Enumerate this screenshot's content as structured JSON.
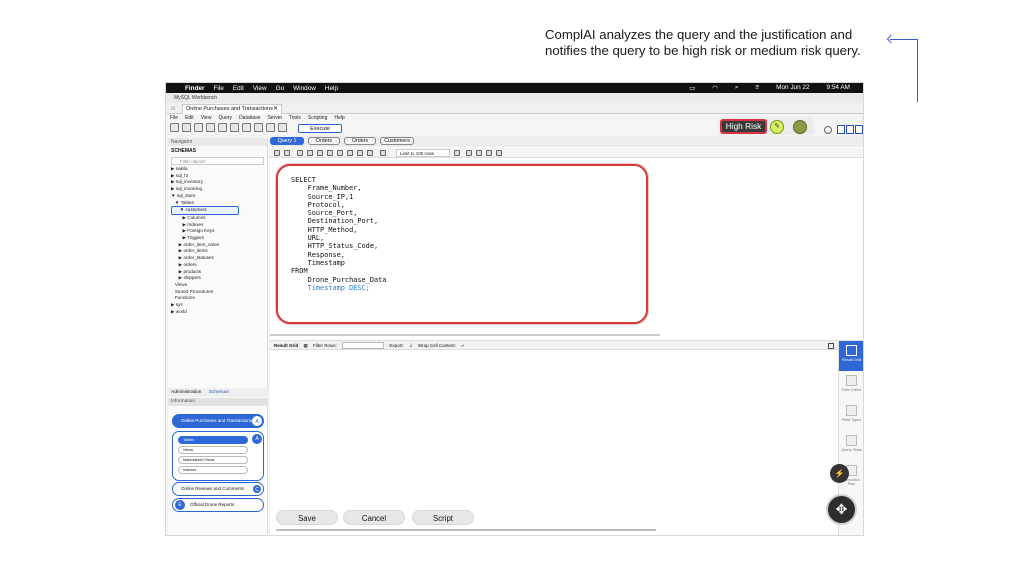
{
  "annotation": {
    "line1": "ComplAI analyzes the query and the justification and",
    "line2": "notifies the query to be high risk or medium risk query."
  },
  "mac_menubar": {
    "apple": "",
    "app": "Finder",
    "items": [
      "File",
      "Edit",
      "View",
      "Go",
      "Window",
      "Help"
    ],
    "date": "Mon Jun 22",
    "time": "9:54 AM"
  },
  "window": {
    "title": "MySQL Workbench",
    "connection_tab": "Online Purchases and Transactions",
    "close_glyph": "✕"
  },
  "app_menu": [
    "File",
    "Edit",
    "View",
    "Query",
    "Database",
    "Server",
    "Tools",
    "Scripting",
    "Help"
  ],
  "toolbar": {
    "execute_label": "Execute"
  },
  "risk": {
    "label": "High Risk",
    "color": "#d63444",
    "pencil_glyph": "✎"
  },
  "sidebar": {
    "navigator": "Navigator",
    "schemas": "SCHEMAS",
    "filter_placeholder": "Filter objects",
    "tree": [
      "▶ sakila",
      "▶ sql_hr",
      "▶ sql_inventory",
      "▶ sql_invoicing",
      "▼ sql_store",
      "   ▼ Tables",
      "      ▼ customers",
      "         ▶ Columns",
      "         ▶ Indexes",
      "         ▶ Foreign Keys",
      "         ▶ Triggers",
      "      ▶ order_item_notes",
      "      ▶ order_items",
      "      ▶ order_statuses",
      "      ▶ orders",
      "      ▶ products",
      "      ▶ shippers",
      "   Views",
      "   Stored Procedures",
      "   Functions",
      "▶ sys",
      "▶ world"
    ],
    "selected_index": 6,
    "tab_admin": "Administration",
    "tab_schemas": "Schemas",
    "information": "Information",
    "groups": {
      "online_purchases": "Online Purchases and Transactions",
      "badge_a": "A",
      "sub_items": [
        "Tables",
        "Views",
        "Materialized Views",
        "Indexes"
      ],
      "online_reviews": "Online Reviews and Comments",
      "badge_c": "C",
      "official_drone": "Official Drone Reports",
      "badge_e": "E"
    }
  },
  "query_tabs": [
    "Query 1",
    "Orders",
    "Orders",
    "Customers"
  ],
  "query_toolbar": {
    "limit_label": "Limit to 100 rows"
  },
  "editor": {
    "lines": [
      "SELECT",
      "    Frame_Number,",
      "    Source_IP,1",
      "    Protocol,",
      "    Source_Port,",
      "    Destination_Port,",
      "    HTTP_Method,",
      "    URL,",
      "    HTTP_Status_Code,",
      "    Response,",
      "    Timestamp",
      "FROM",
      "    Drone_Purchase_Data"
    ],
    "highlight_line": "    Timestamp DESC;"
  },
  "result_bar": {
    "result_grid": "Result Grid",
    "filter_rows": "Filter Rows:",
    "export": "Export:",
    "wrap": "Wrap Cell Content:"
  },
  "right_panel": [
    "Result Grid",
    "Form Editor",
    "Field Types",
    "Query Stats",
    "Execution Plan"
  ],
  "buttons": {
    "save": "Save",
    "cancel": "Cancel",
    "script": "Script"
  },
  "fab": {
    "small_glyph": "⚡",
    "big_glyph": "✥"
  }
}
